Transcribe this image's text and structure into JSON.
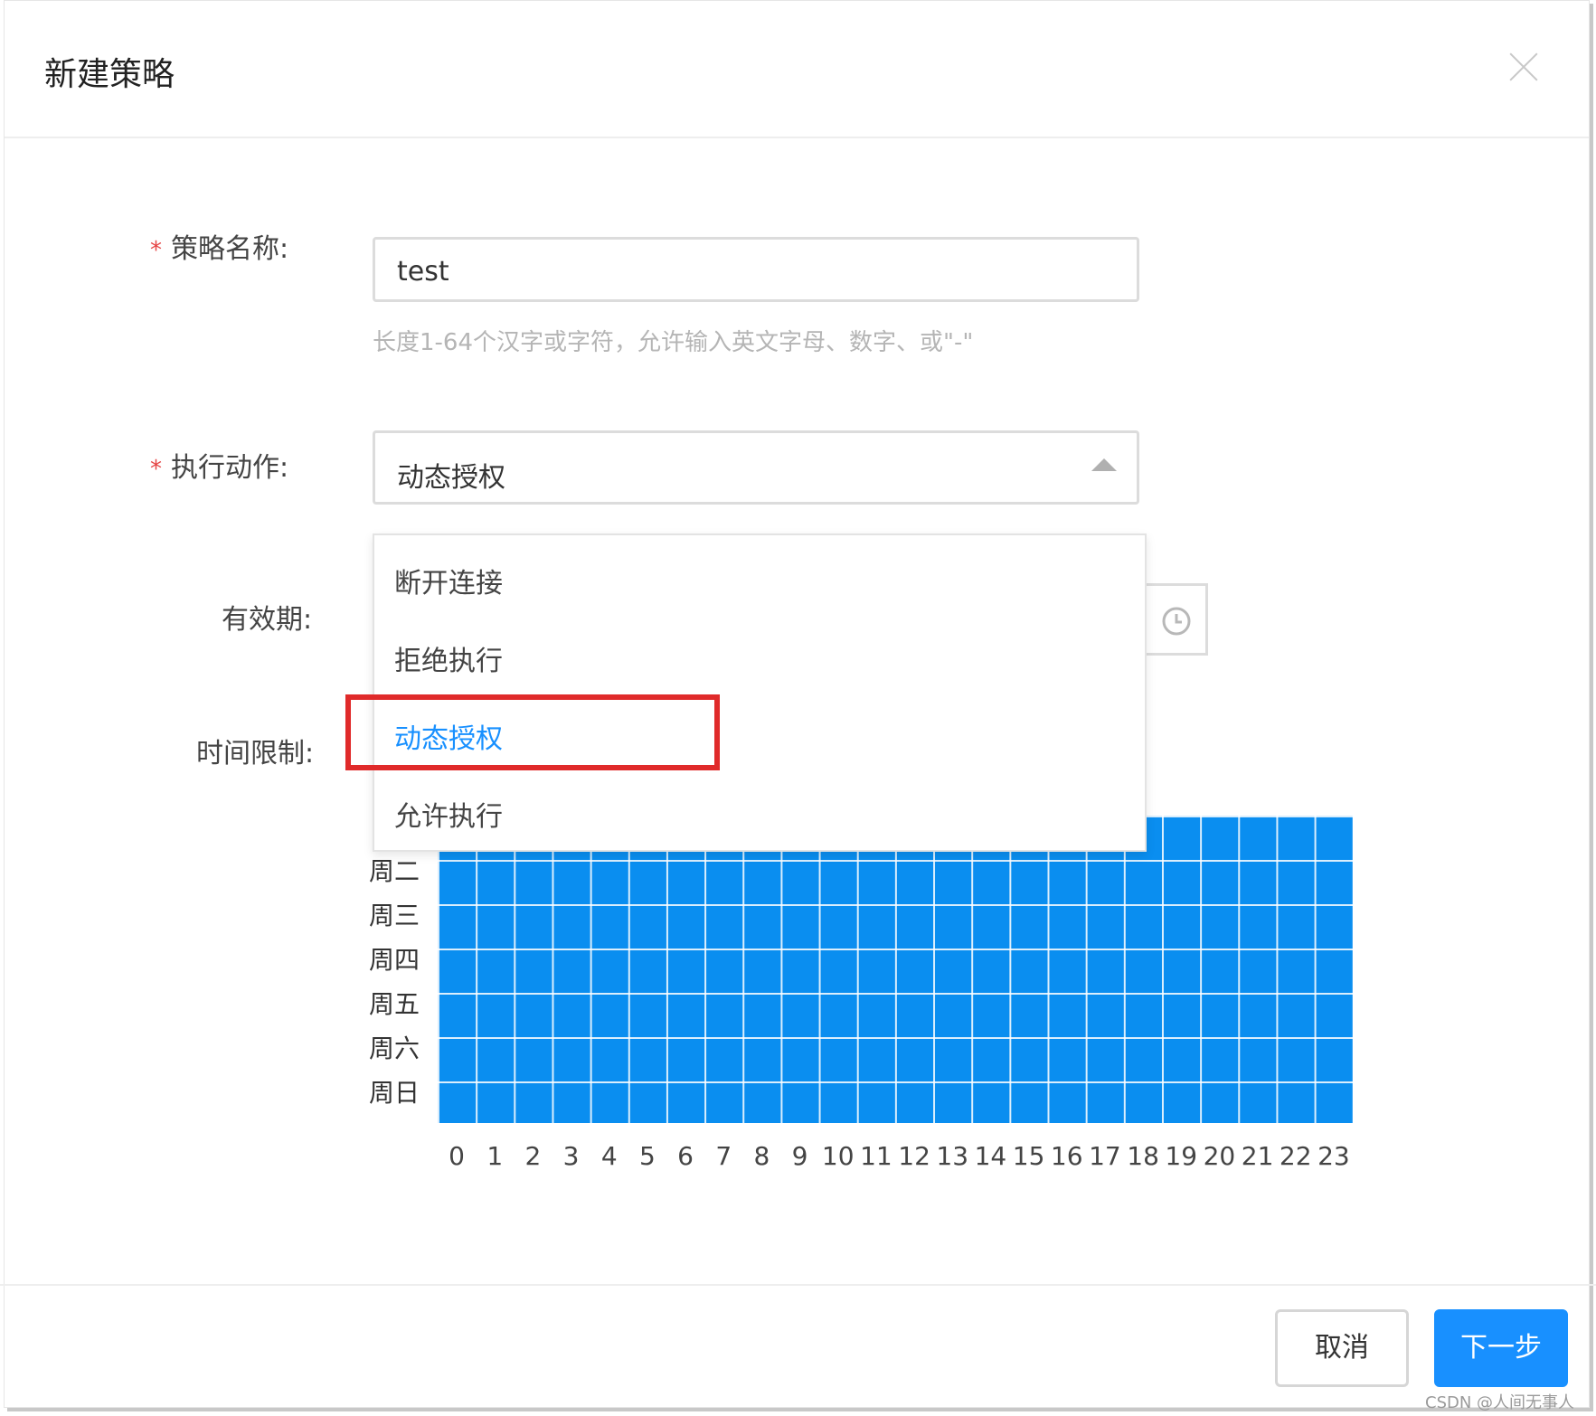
{
  "dialog": {
    "title": "新建策略"
  },
  "form": {
    "name": {
      "label": "策略名称:",
      "value": "test",
      "hint": "长度1-64个汉字或字符，允许输入英文字母、数字、或\"-\""
    },
    "action": {
      "label": "执行动作:",
      "selected": "动态授权",
      "options": [
        "断开连接",
        "拒绝执行",
        "动态授权",
        "允许执行"
      ],
      "active_index": 2
    },
    "validity": {
      "label": "有效期:"
    },
    "time_limit": {
      "label": "时间限制:",
      "days_visible": [
        "周二",
        "周三",
        "周四",
        "周五",
        "周六",
        "周日"
      ],
      "hours": [
        "0",
        "1",
        "2",
        "3",
        "4",
        "5",
        "6",
        "7",
        "8",
        "9",
        "10",
        "11",
        "12",
        "13",
        "14",
        "15",
        "16",
        "17",
        "18",
        "19",
        "20",
        "21",
        "22",
        "23"
      ]
    }
  },
  "footer": {
    "cancel_label": "取消",
    "next_label": "下一步"
  },
  "watermark": "CSDN @人间无事人",
  "colors": {
    "accent": "#1890ff",
    "grid_fill": "#0a8ef0",
    "required": "#e54545",
    "highlight": "#e02a2a"
  }
}
